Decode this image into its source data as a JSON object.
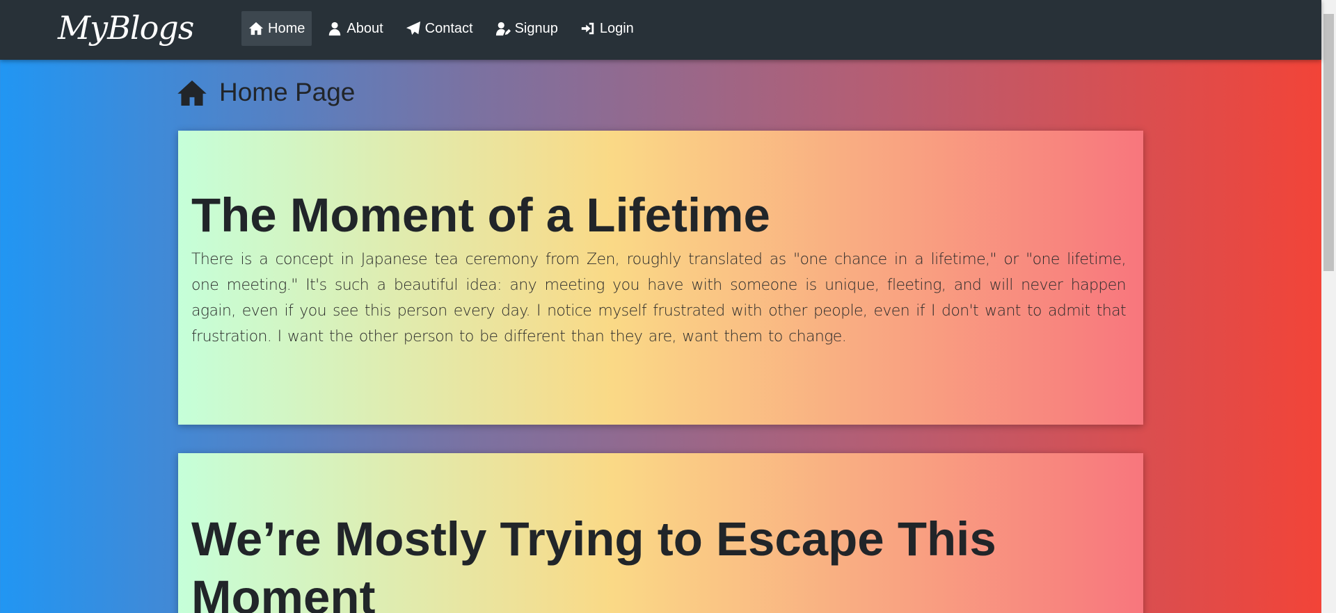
{
  "navbar": {
    "brand": "MyBlogs",
    "items": [
      {
        "label": "Home",
        "icon": "home-icon",
        "active": true
      },
      {
        "label": "About",
        "icon": "user-icon",
        "active": false
      },
      {
        "label": "Contact",
        "icon": "paper-plane-icon",
        "active": false
      },
      {
        "label": "Signup",
        "icon": "user-edit-icon",
        "active": false
      },
      {
        "label": "Login",
        "icon": "sign-in-icon",
        "active": false
      }
    ]
  },
  "page": {
    "heading": "Home Page",
    "heading_icon": "home-icon"
  },
  "posts": [
    {
      "title": "The Moment of a Lifetime",
      "body": "There is a concept in Japanese tea ceremony from Zen, roughly translated as \"one chance in a lifetime,\" or \"one lifetime, one meeting.\" It's such a beautiful idea: any meeting you have with someone is unique, fleeting, and will never happen again, even if you see this person every day. I notice myself frustrated with other people, even if I don't want to admit that frustration. I want the other person to be different than they are, want them to change."
    },
    {
      "title": "We’re Mostly Trying to Escape This Moment"
    }
  ],
  "colors": {
    "navbar_bg": "#283138",
    "background_gradient": [
      "#2196f3",
      "#f44336"
    ],
    "card_gradient": [
      "#c5ffd9",
      "#fad986",
      "#f8767d"
    ]
  }
}
